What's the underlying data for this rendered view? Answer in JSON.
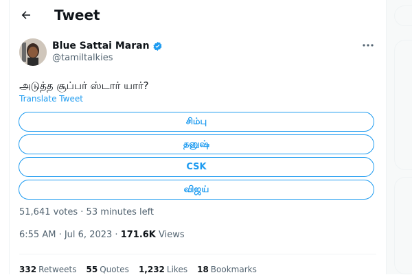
{
  "header": {
    "title": "Tweet",
    "back_icon": "arrow-left-icon"
  },
  "tweet": {
    "author_name": "Blue Sattai Maran",
    "handle": "@tamiltalkies",
    "verified_icon": "verified-badge-icon",
    "more_icon": "more-dots-icon",
    "text": "அடுத்த சூப்பர் ஸ்டார் யார்?",
    "translate_label": "Translate Tweet",
    "poll": {
      "options": [
        "சிம்பு",
        "தனுஷ்",
        "CSK",
        "விஜய்"
      ],
      "votes": "51,641 votes",
      "separator": " · ",
      "time_left": "53 minutes left"
    },
    "time": "6:55 AM",
    "date": "Jul 6, 2023",
    "views_count": "171.6K",
    "views_label": "Views",
    "stats": {
      "retweets": {
        "count": "332",
        "label": "Retweets"
      },
      "quotes": {
        "count": "55",
        "label": "Quotes"
      },
      "likes": {
        "count": "1,232",
        "label": "Likes"
      },
      "bookmarks": {
        "count": "18",
        "label": "Bookmarks"
      }
    }
  },
  "colors": {
    "accent": "#1d9bf0",
    "text": "#0f1419",
    "secondary": "#536471",
    "border": "#eff3f4"
  }
}
